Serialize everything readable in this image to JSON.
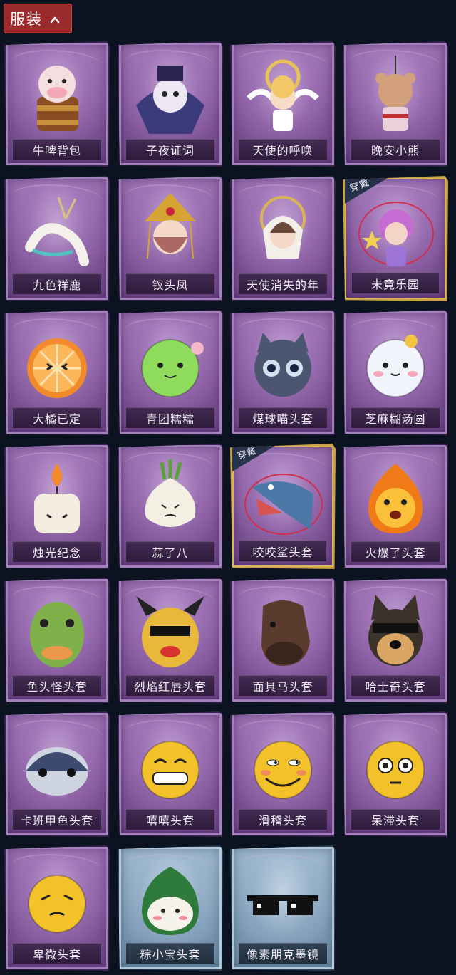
{
  "header": {
    "label": "服装"
  },
  "badge_text": "穿戴",
  "items": [
    {
      "name": "牛啤背包",
      "icon": "cow-beer-backpack-icon",
      "equipped": false,
      "theme": "purple"
    },
    {
      "name": "子夜证词",
      "icon": "midnight-plague-doctor-icon",
      "equipped": false,
      "theme": "purple"
    },
    {
      "name": "天使的呼唤",
      "icon": "angel-call-icon",
      "equipped": false,
      "theme": "purple"
    },
    {
      "name": "晚安小熊",
      "icon": "goodnight-bear-icon",
      "equipped": false,
      "theme": "purple"
    },
    {
      "name": "九色祥鹿",
      "icon": "nine-color-deer-icon",
      "equipped": false,
      "theme": "purple"
    },
    {
      "name": "钗头凤",
      "icon": "phoenix-hairpin-icon",
      "equipped": false,
      "theme": "purple"
    },
    {
      "name": "天使消失的年",
      "icon": "angel-vanished-year-icon",
      "equipped": false,
      "theme": "purple"
    },
    {
      "name": "未竟乐园",
      "icon": "unfinished-paradise-icon",
      "equipped": true,
      "theme": "purple"
    },
    {
      "name": "大橘已定",
      "icon": "orange-slice-icon",
      "equipped": false,
      "theme": "purple"
    },
    {
      "name": "青团糯糯",
      "icon": "green-rice-ball-icon",
      "equipped": false,
      "theme": "purple"
    },
    {
      "name": "煤球喵头套",
      "icon": "coal-cat-head-icon",
      "equipped": false,
      "theme": "purple"
    },
    {
      "name": "芝麻糊汤圆",
      "icon": "sesame-dumpling-icon",
      "equipped": false,
      "theme": "purple"
    },
    {
      "name": "烛光纪念",
      "icon": "candle-icon",
      "equipped": false,
      "theme": "purple"
    },
    {
      "name": "蒜了八",
      "icon": "garlic-icon",
      "equipped": false,
      "theme": "purple"
    },
    {
      "name": "咬咬鲨头套",
      "icon": "shark-head-icon",
      "equipped": true,
      "theme": "purple"
    },
    {
      "name": "火爆了头套",
      "icon": "fire-head-icon",
      "equipped": false,
      "theme": "purple"
    },
    {
      "name": "鱼头怪头套",
      "icon": "fish-monster-head-icon",
      "equipped": false,
      "theme": "purple"
    },
    {
      "name": "烈焰红唇头套",
      "icon": "red-lips-pikachu-head-icon",
      "equipped": false,
      "theme": "purple"
    },
    {
      "name": "面具马头套",
      "icon": "horse-mask-icon",
      "equipped": false,
      "theme": "purple"
    },
    {
      "name": "哈士奇头套",
      "icon": "husky-head-icon",
      "equipped": false,
      "theme": "purple"
    },
    {
      "name": "卡班甲鱼头套",
      "icon": "turtle-fish-head-icon",
      "equipped": false,
      "theme": "purple"
    },
    {
      "name": "嘻嘻头套",
      "icon": "grin-emoji-head-icon",
      "equipped": false,
      "theme": "purple"
    },
    {
      "name": "滑稽头套",
      "icon": "funny-emoji-head-icon",
      "equipped": false,
      "theme": "purple"
    },
    {
      "name": "呆滞头套",
      "icon": "dull-emoji-head-icon",
      "equipped": false,
      "theme": "purple"
    },
    {
      "name": "卑微头套",
      "icon": "humble-emoji-head-icon",
      "equipped": false,
      "theme": "purple"
    },
    {
      "name": "粽小宝头套",
      "icon": "zongzi-head-icon",
      "equipped": false,
      "theme": "blue"
    },
    {
      "name": "像素朋克墨镜",
      "icon": "pixel-sunglasses-icon",
      "equipped": false,
      "theme": "blue"
    }
  ]
}
